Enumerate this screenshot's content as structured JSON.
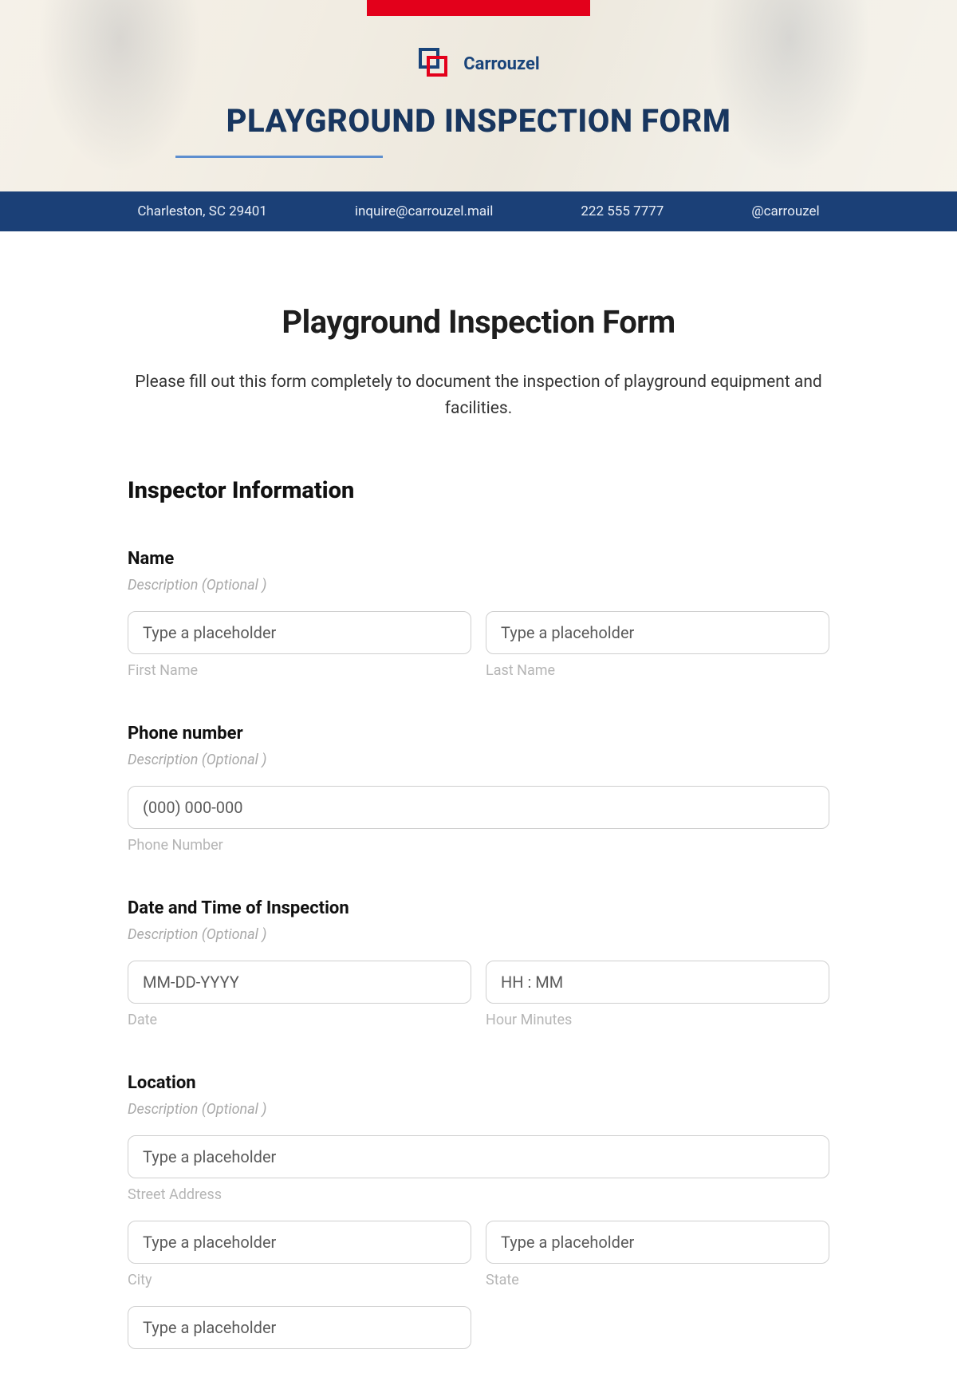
{
  "hero": {
    "brand_name": "Carrouzel",
    "title": "PLAYGROUND INSPECTION FORM",
    "info_bar": {
      "address": "Charleston, SC 29401",
      "email": "inquire@carrouzel.mail",
      "phone": "222 555 7777",
      "social": "@carrouzel"
    }
  },
  "form": {
    "title": "Playground Inspection Form",
    "subtitle": "Please fill out this form completely to document the inspection of playground equipment and facilities.",
    "section_heading": "Inspector Information",
    "desc_optional": "Description  (Optional )",
    "placeholder_generic": "Type a placeholder",
    "name": {
      "label": "Name",
      "first_sub": "First Name",
      "last_sub": "Last Name"
    },
    "phone": {
      "label": "Phone number",
      "placeholder": "(000) 000-000",
      "sub": "Phone Number"
    },
    "datetime": {
      "label": "Date and Time of Inspection",
      "date_placeholder": "MM-DD-YYYY",
      "time_placeholder": "HH : MM",
      "date_sub": "Date",
      "time_sub": "Hour Minutes"
    },
    "location": {
      "label": "Location",
      "street_sub": "Street Address",
      "city_sub": "City",
      "state_sub": "State"
    }
  }
}
